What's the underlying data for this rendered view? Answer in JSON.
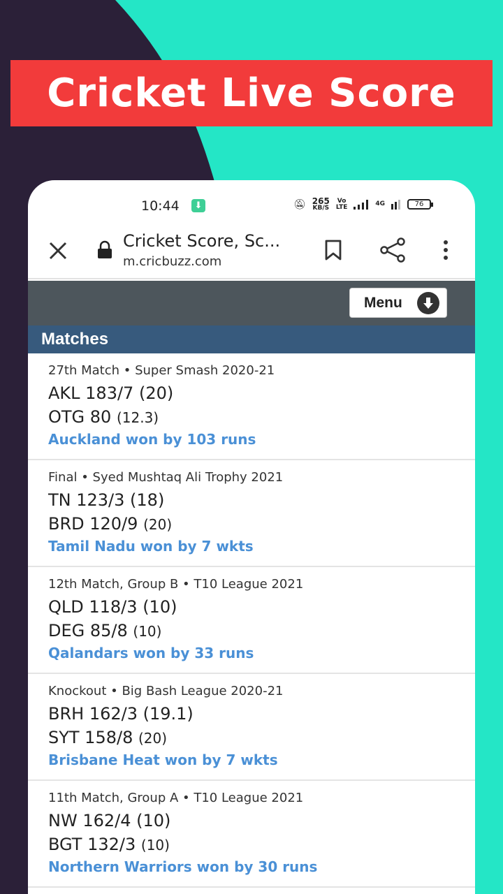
{
  "banner": {
    "title": "Cricket Live Score"
  },
  "colors": {
    "teal": "#24e6c6",
    "dark": "#2b2038",
    "banner_red": "#f23b3b",
    "header_gray": "#4d565c",
    "section_blue": "#375a7d",
    "result_blue": "#4a90d6"
  },
  "status_bar": {
    "time": "10:44",
    "download_icon": "download-icon",
    "speed_value": "265",
    "speed_unit": "KB/S",
    "volte_top": "Vo",
    "volte_bottom": "LTE",
    "network": "4G",
    "battery": "76"
  },
  "browser": {
    "page_title": "Cricket Score, Sc...",
    "url": "m.cricbuzz.com",
    "icons": [
      "close-icon",
      "lock-icon",
      "bookmark-icon",
      "share-icon",
      "more-vert-icon"
    ]
  },
  "site": {
    "menu_label": "Menu",
    "section_title": "Matches"
  },
  "matches": [
    {
      "series": "27th Match • Super Smash 2020-21",
      "team1": "AKL 183/7",
      "team1_overs": "(20)",
      "team2": "OTG 80",
      "team2_overs": "(12.3)",
      "result": "Auckland won by 103 runs"
    },
    {
      "series": "Final • Syed Mushtaq Ali Trophy 2021",
      "team1": "TN 123/3",
      "team1_overs": "(18)",
      "team2": "BRD 120/9",
      "team2_overs": "(20)",
      "result": "Tamil Nadu won by 7 wkts"
    },
    {
      "series": "12th Match, Group B • T10 League 2021",
      "team1": "QLD 118/3",
      "team1_overs": "(10)",
      "team2": "DEG 85/8",
      "team2_overs": "(10)",
      "result": "Qalandars won by 33 runs"
    },
    {
      "series": "Knockout • Big Bash League 2020-21",
      "team1": "BRH 162/3",
      "team1_overs": "(19.1)",
      "team2": "SYT 158/8",
      "team2_overs": "(20)",
      "result": "Brisbane Heat won by 7 wkts"
    },
    {
      "series": "11th Match, Group A • T10 League 2021",
      "team1": "NW 162/4",
      "team1_overs": "(10)",
      "team2": "BGT 132/3",
      "team2_overs": "(10)",
      "result": "Northern Warriors won by 30 runs"
    }
  ]
}
